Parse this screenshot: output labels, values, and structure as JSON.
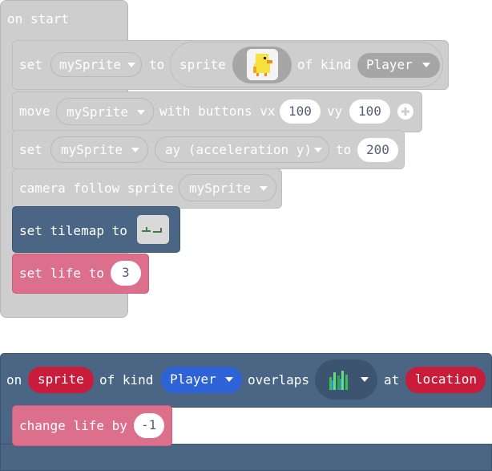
{
  "on_start": {
    "label": "on start"
  },
  "set_sprite": {
    "set": "set",
    "var": "mySprite",
    "to": "to",
    "sprite": "sprite",
    "of_kind": "of kind",
    "kind": "Player"
  },
  "move": {
    "move": "move",
    "var": "mySprite",
    "with_buttons": "with buttons vx",
    "vx": "100",
    "vy_label": "vy",
    "vy": "100"
  },
  "set_ay": {
    "set": "set",
    "var": "mySprite",
    "prop": "ay (acceleration y)",
    "to": "to",
    "value": "200"
  },
  "camera": {
    "label": "camera follow sprite",
    "var": "mySprite"
  },
  "tilemap": {
    "label": "set tilemap to"
  },
  "life": {
    "label": "set life to",
    "value": "3"
  },
  "overlap": {
    "on": "on",
    "sprite": "sprite",
    "of_kind": "of kind",
    "kind": "Player",
    "overlaps": "overlaps",
    "at": "at",
    "location": "location"
  },
  "change_life": {
    "label": "change life by",
    "value": "-1"
  },
  "colors": {
    "grey": "#cecece",
    "slate": "#4b6584",
    "pink": "#dc6f8c",
    "red": "#c91c3a",
    "blue": "#2e63d8"
  }
}
